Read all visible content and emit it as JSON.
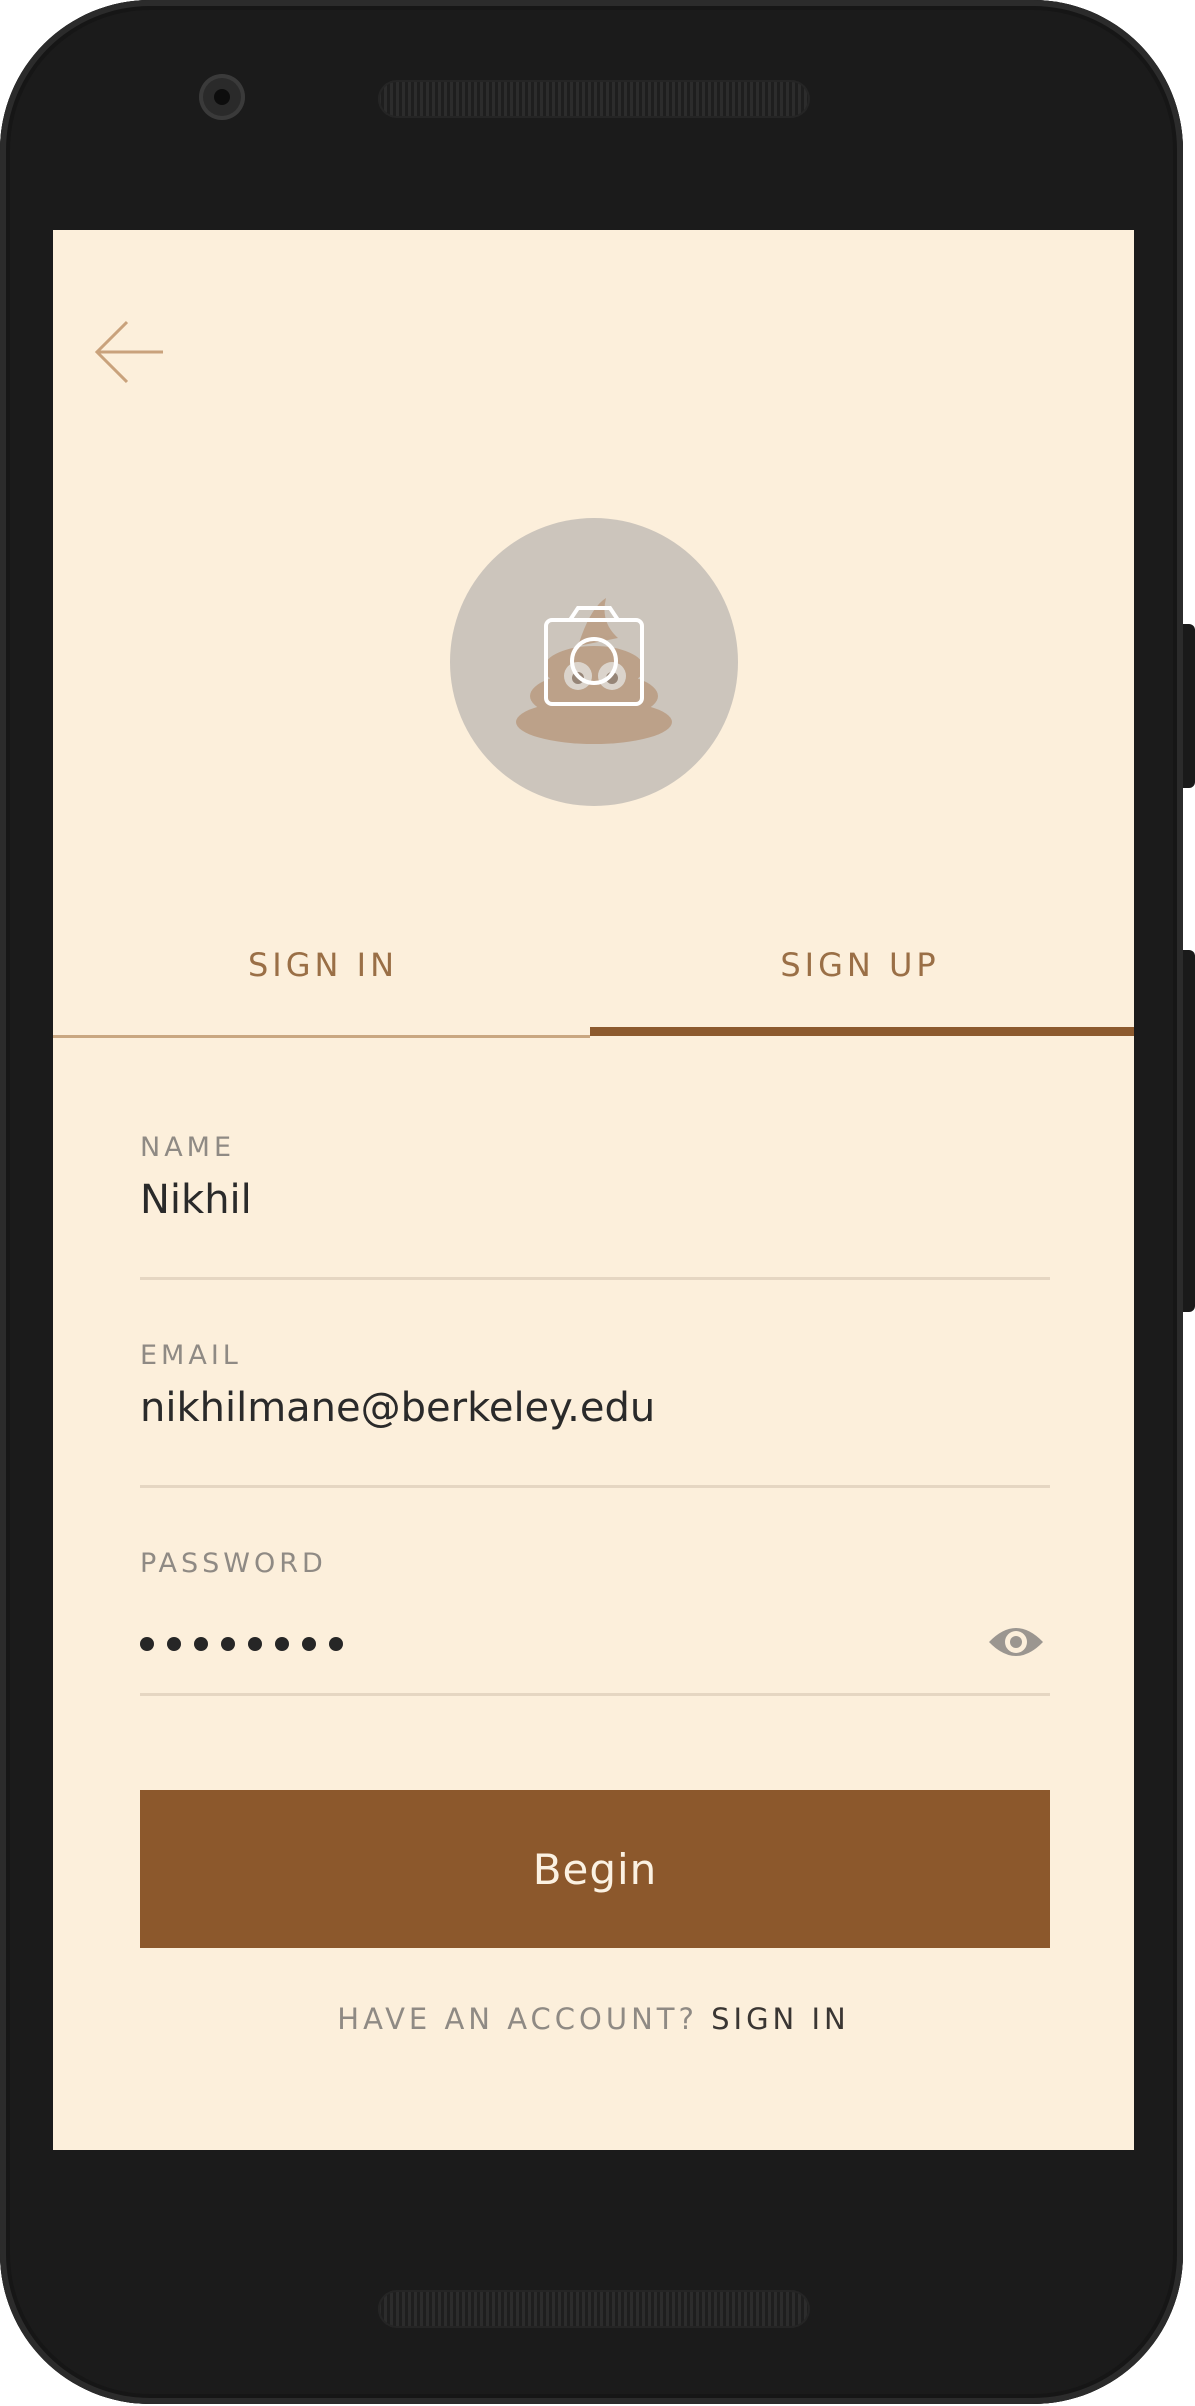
{
  "header": {
    "back_icon": "arrow-left-icon"
  },
  "avatar": {
    "icon": "camera-icon",
    "placeholder_emoji": "💩"
  },
  "tabs": [
    {
      "label": "SIGN IN",
      "active": false
    },
    {
      "label": "SIGN UP",
      "active": true
    }
  ],
  "form": {
    "name": {
      "label": "NAME",
      "value": "Nikhil"
    },
    "email": {
      "label": "EMAIL",
      "value": "nikhilmane@berkeley.edu"
    },
    "password": {
      "label": "PASSWORD",
      "masked_length": 8,
      "toggle_icon": "eye-icon"
    }
  },
  "submit": {
    "label": "Begin"
  },
  "footer": {
    "question": "HAVE AN ACCOUNT?",
    "link": "SIGN IN"
  },
  "colors": {
    "screen_background": "#fcefdb",
    "accent": "#8c582c",
    "tab_text": "#9a6f46",
    "muted_text": "#8f8a84"
  }
}
